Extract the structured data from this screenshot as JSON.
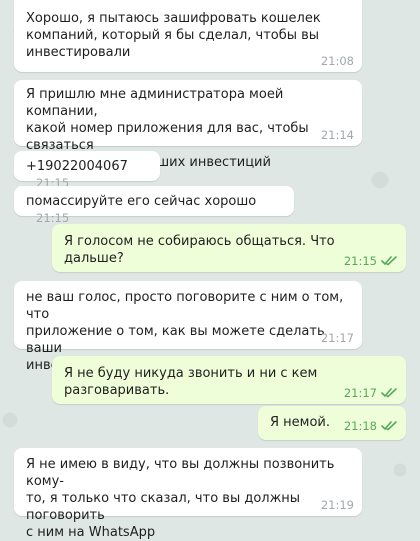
{
  "colors": {
    "incoming_bubble": "#ffffff",
    "outgoing_bubble": "#eefed9",
    "time_incoming": "#a2a8ad",
    "time_outgoing": "#56a858",
    "read_ticks": "#56a858",
    "background": "#dfe7e4"
  },
  "messages": [
    {
      "direction": "incoming",
      "text": "Хорошо, я пытаюсь зашифровать кошелек\nкомпаний, который я бы сделал, чтобы вы\nинвестировали",
      "time": "21:08"
    },
    {
      "direction": "incoming",
      "text": "Я пришлю мне администратора моей компании,\nкакой номер приложения для вас, чтобы связаться\nс ним по поводу ваших инвестиций",
      "time": "21:14"
    },
    {
      "direction": "incoming",
      "text": "+19022004067",
      "time": "21:15"
    },
    {
      "direction": "incoming",
      "text": "помассируйте его сейчас хорошо",
      "time": "21:15"
    },
    {
      "direction": "outgoing",
      "text": "Я голосом не собираюсь общаться. Что дальше?",
      "time": "21:15",
      "status_icon": "double-check-icon"
    },
    {
      "direction": "incoming",
      "text": "не ваш голос, просто поговорите с ним о том, что\nприложение о том, как вы можете сделать ваши\nинвестиции в порядке, хорошо",
      "time": "21:17"
    },
    {
      "direction": "outgoing",
      "text": "Я не буду никуда звонить и ни с кем разговаривать.",
      "time": "21:17",
      "status_icon": "double-check-icon"
    },
    {
      "direction": "outgoing",
      "text": "Я немой.",
      "time": "21:18",
      "status_icon": "double-check-icon"
    },
    {
      "direction": "incoming",
      "text": "Я не имею в виду, что вы должны позвонить кому-\nто, я только что сказал, что вы должны поговорить\nс ним на WhatsApp",
      "time": "21:19"
    }
  ]
}
